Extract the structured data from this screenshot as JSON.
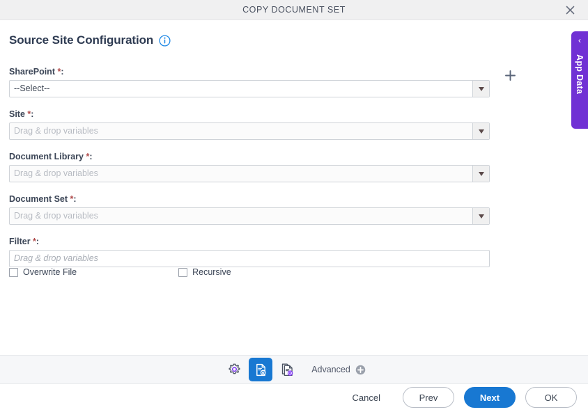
{
  "window": {
    "title": "COPY DOCUMENT SET",
    "close_icon": "close-icon"
  },
  "page": {
    "heading": "Source Site Configuration",
    "info_icon": "info-circle-icon"
  },
  "form": {
    "fields": [
      {
        "label": "SharePoint",
        "required_mark": "*",
        "colon": ":",
        "control": "dropdown",
        "value": "--Select--",
        "placeholder": "",
        "disabled": false,
        "has_add_button": true,
        "add_icon": "plus-icon",
        "arrow_icon": "chevron-down-icon"
      },
      {
        "label": "Site",
        "required_mark": "*",
        "colon": ":",
        "control": "dropdown",
        "value": "",
        "placeholder": "Drag & drop variables",
        "disabled": true,
        "has_add_button": false,
        "arrow_icon": "chevron-down-icon"
      },
      {
        "label": "Document Library",
        "required_mark": "*",
        "colon": ":",
        "control": "dropdown",
        "value": "",
        "placeholder": "Drag & drop variables",
        "disabled": true,
        "has_add_button": false,
        "arrow_icon": "chevron-down-icon"
      },
      {
        "label": "Document Set",
        "required_mark": "*",
        "colon": ":",
        "control": "dropdown",
        "value": "",
        "placeholder": "Drag & drop variables",
        "disabled": true,
        "has_add_button": false,
        "arrow_icon": "chevron-down-icon"
      },
      {
        "label": "Filter",
        "required_mark": "*",
        "colon": ":",
        "control": "textbox",
        "value": "",
        "placeholder": "Drag & drop variables",
        "disabled": false,
        "has_add_button": false
      }
    ],
    "checkboxes": [
      {
        "label": "Overwrite File",
        "checked": false
      },
      {
        "label": "Recursive",
        "checked": false
      }
    ]
  },
  "toolbar": {
    "icons": [
      {
        "name": "gear-icon",
        "active": false
      },
      {
        "name": "document-settings-icon",
        "active": true
      },
      {
        "name": "document-copy-settings-icon",
        "active": false
      }
    ],
    "advanced_label": "Advanced",
    "advanced_icon": "plus-circle-icon"
  },
  "actions": {
    "cancel": "Cancel",
    "prev": "Prev",
    "next": "Next",
    "ok": "OK"
  },
  "app_data_tab": {
    "label": "App Data",
    "chevron": "‹",
    "color": "#7031d4"
  },
  "colors": {
    "accent_blue": "#1878d2",
    "purple": "#7031d4",
    "required_red": "#b04a4a",
    "header_bg": "#f0f0f1",
    "toolbar_bg": "#f6f7f9"
  }
}
